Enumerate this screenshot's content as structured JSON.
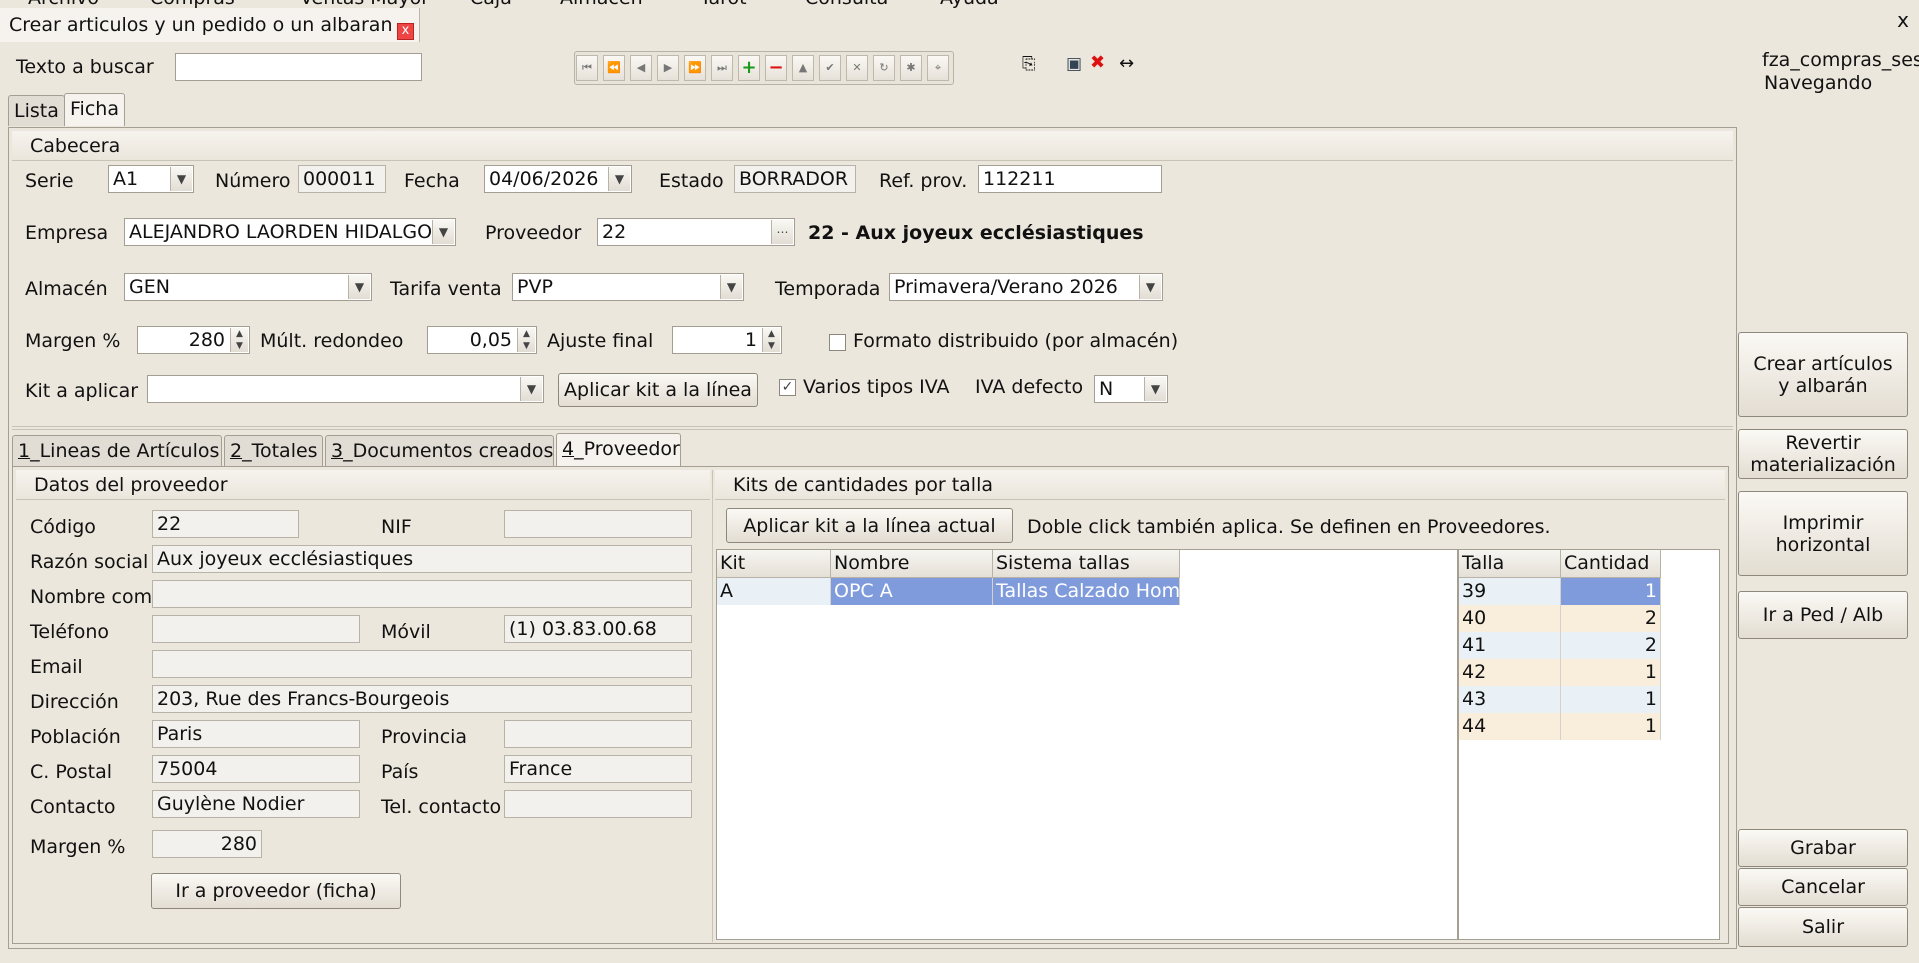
{
  "window": {
    "title": "Crear articulos y un pedido o un albaran",
    "close_label": "x",
    "close_window": "x"
  },
  "top_menu": [
    "Archivo",
    "Compras",
    "Ventas Mayor",
    "Caja",
    "Almacen",
    "Tarot",
    "Consulta",
    "Ayuda"
  ],
  "search": {
    "label": "Texto a buscar",
    "value": ""
  },
  "session": {
    "user": "fza_compras_ses",
    "mode": "Navegando"
  },
  "main_tabs": [
    "Lista",
    "Ficha"
  ],
  "cabecera": {
    "title": "Cabecera",
    "serie_label": "Serie",
    "serie": "A1",
    "numero_label": "Número",
    "numero": "000011",
    "fecha_label": "Fecha",
    "fecha": "04/06/2026",
    "estado_label": "Estado",
    "estado": "BORRADOR",
    "refprov_label": "Ref. prov.",
    "refprov": "112211",
    "empresa_label": "Empresa",
    "empresa": "ALEJANDRO LAORDEN HIDALGO",
    "proveedor_label": "Proveedor",
    "proveedor": "22",
    "proveedor_desc": "22 - Aux joyeux ecclésiastiques",
    "almacen_label": "Almacén",
    "almacen": "GEN",
    "tarifa_label": "Tarifa venta",
    "tarifa": "PVP",
    "temporada_label": "Temporada",
    "temporada": "Primavera/Verano 2026",
    "margen_label": "Margen %",
    "margen": "280",
    "mult_label": "Múlt. redondeo",
    "mult": "0,05",
    "ajuste_label": "Ajuste final",
    "ajuste": "1",
    "formato_label": "Formato distribuido (por almacén)",
    "kit_label": "Kit a aplicar",
    "kit": "",
    "aplicar_kit_label": "Aplicar kit a la línea",
    "varios_iva_label": "Varios tipos IVA",
    "iva_defecto_label": "IVA defecto",
    "iva_defecto": "N"
  },
  "side_buttons": {
    "crear": "Crear artículos y albarán",
    "revertir": "Revertir materialización",
    "imprimir": "Imprimir horizontal",
    "ir_ped": "Ir a Ped / Alb",
    "grabar": "Grabar",
    "cancelar": "Cancelar",
    "salir": "Salir"
  },
  "sub_tabs": [
    {
      "num": "1",
      "label": "_Lineas de Artículos"
    },
    {
      "num": "2",
      "label": "_Totales"
    },
    {
      "num": "3",
      "label": "_Documentos creados"
    },
    {
      "num": "4",
      "label": "_Proveedor"
    }
  ],
  "proveedor_datos": {
    "title": "Datos del proveedor",
    "codigo_label": "Código",
    "codigo": "22",
    "nif_label": "NIF",
    "nif": "",
    "razon_label": "Razón social",
    "razon": "Aux joyeux ecclésiastiques",
    "nombre_label": "Nombre com",
    "nombre": "",
    "telefono_label": "Teléfono",
    "telefono": "",
    "movil_label": "Móvil",
    "movil": "(1) 03.83.00.68",
    "email_label": "Email",
    "email": "",
    "direccion_label": "Dirección",
    "direccion": "203, Rue des Francs-Bourgeois",
    "poblacion_label": "Población",
    "poblacion": "Paris",
    "provincia_label": "Provincia",
    "provincia": "",
    "cpostal_label": "C. Postal",
    "cpostal": "75004",
    "pais_label": "País",
    "pais": "France",
    "contacto_label": "Contacto",
    "contacto": "Guylène Nodier",
    "telcontacto_label": "Tel. contacto",
    "telcontacto": "",
    "margen_label": "Margen %",
    "margen": "280",
    "ir_proveedor_label": "Ir a proveedor (ficha)"
  },
  "kits": {
    "title": "Kits de cantidades por talla",
    "aplicar_label": "Aplicar kit a la línea actual",
    "hint": "Doble click también aplica. Se definen en Proveedores.",
    "columns": [
      "Kit",
      "Nombre",
      "Sistema tallas"
    ],
    "rows": [
      [
        "A",
        "OPC A",
        "Tallas Calzado Hom"
      ]
    ],
    "size_columns": [
      "Talla",
      "Cantidad"
    ],
    "sizes": [
      [
        "39",
        "1"
      ],
      [
        "40",
        "2"
      ],
      [
        "41",
        "2"
      ],
      [
        "42",
        "1"
      ],
      [
        "43",
        "1"
      ],
      [
        "44",
        "1"
      ]
    ]
  },
  "colors": {
    "accent": "#7f9bdc",
    "row_alt_a": "#eaf1f6",
    "row_alt_b": "#f9eedb"
  }
}
